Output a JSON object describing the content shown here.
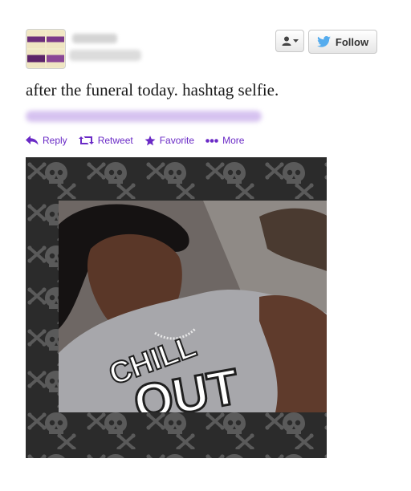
{
  "tweet": {
    "text": "after the funeral today. hashtag selfie."
  },
  "header": {
    "follow_label": "Follow",
    "user_menu_icon": "user-dropdown-icon",
    "bird_icon": "twitter-bird-icon"
  },
  "actions": {
    "reply": "Reply",
    "retweet": "Retweet",
    "favorite": "Favorite",
    "more": "More"
  },
  "photo": {
    "shirt_line1": "CHILL",
    "shirt_line2": "OUT"
  },
  "colors": {
    "action_purple": "#6a2ac6",
    "twitter_blue": "#55acee",
    "pattern_bg": "#2b2b2b"
  }
}
